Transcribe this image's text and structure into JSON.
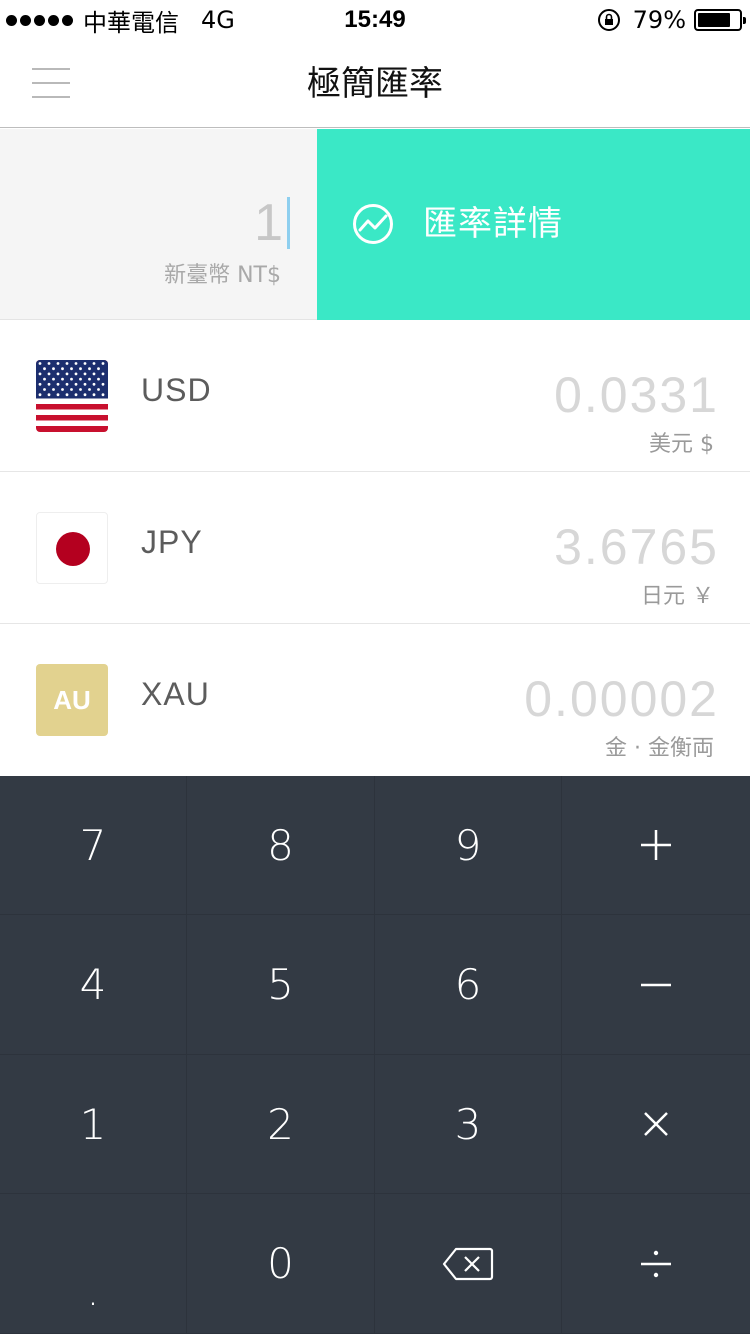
{
  "status_bar": {
    "carrier": "中華電信",
    "network": "4G",
    "time": "15:49",
    "battery_percent": "79%",
    "battery_level": 0.79
  },
  "nav": {
    "title": "極簡匯率"
  },
  "input": {
    "amount": "1",
    "currency_label": "新臺幣 NT$"
  },
  "detail_button": {
    "label": "匯率詳情"
  },
  "currencies": [
    {
      "code": "USD",
      "value": "0.0331",
      "unit": "美元 $",
      "flag": "us-flag"
    },
    {
      "code": "JPY",
      "value": "3.6765",
      "unit": "日元 ￥",
      "flag": "jp-flag"
    },
    {
      "code": "XAU",
      "value": "0.00002",
      "unit": "金 · 金衡両",
      "flag": "gold-badge",
      "badge_text": "AU"
    }
  ],
  "keypad": {
    "k7": "7",
    "k8": "8",
    "k9": "9",
    "k4": "4",
    "k5": "5",
    "k6": "6",
    "k1": "1",
    "k2": "2",
    "k3": "3",
    "kdot": ".",
    "k0": "0"
  },
  "colors": {
    "accent": "#3ae8c6",
    "keypad_bg": "#333a44",
    "gold": "#e2d28f",
    "jp_red": "#b4001f"
  }
}
